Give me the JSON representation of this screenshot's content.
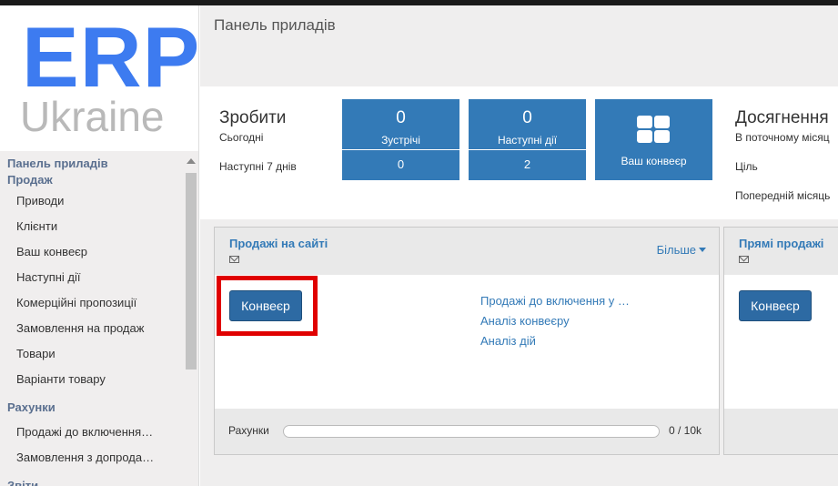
{
  "sidebar": {
    "logo_main": "ERP",
    "logo_sub": "Ukraine",
    "head_dashboard": "Панель приладів",
    "head_sales": "Продаж",
    "sales_items": [
      "Приводи",
      "Клієнти",
      "Ваш конвеєр",
      "Наступні дії",
      "Комерційні пропозиції",
      "Замовлення на продаж",
      "Товари",
      "Варіанти товару"
    ],
    "section_invoices": "Рахунки",
    "invoice_items": [
      "Продажі до включення…",
      "Замовлення з допрода…"
    ],
    "section_reports": "Звіти"
  },
  "header": {
    "title": "Панель приладів"
  },
  "stats": {
    "todo_title": "Зробити",
    "todo_today": "Сьогодні",
    "todo_next7": "Наступні 7 днів",
    "meetings": {
      "count": "0",
      "label": "Зустрічі",
      "next7": "0"
    },
    "next_actions": {
      "count": "0",
      "label": "Наступні дії",
      "next7": "2"
    },
    "pipeline_label": "Ваш конвеєр",
    "ach_title": "Досягнення",
    "ach_sub": "В поточному місяц",
    "ach_goal": "Ціль",
    "ach_prev": "Попередній місяць"
  },
  "card_web": {
    "title": "Продажі на сайті",
    "more": "Більше",
    "button": "Конвеєр",
    "links": [
      "Продажі до включення у …",
      "Аналіз конвеєру",
      "Аналіз дій"
    ],
    "footer_label": "Рахунки",
    "footer_value": "0 / 10k",
    "invoiced_fraction": 0
  },
  "card_direct": {
    "title": "Прямі продажі",
    "button": "Конвеєр"
  },
  "colors": {
    "accent": "#337ab7",
    "highlight": "#e00000",
    "logo_blue": "#3d7bf0"
  }
}
